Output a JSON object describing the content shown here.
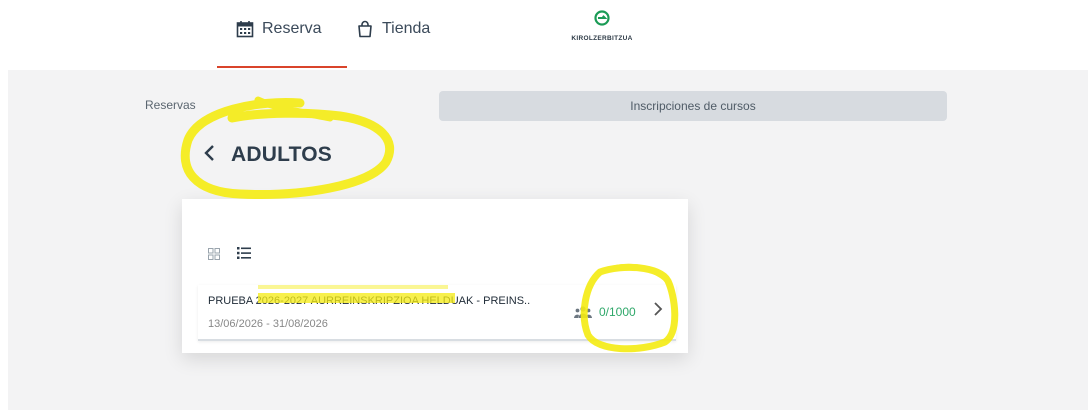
{
  "nav": {
    "reserva_label": "Reserva",
    "tienda_label": "Tienda",
    "logo_text": "KIROLZERBITZUA",
    "accent": "#d9442b",
    "logo_color": "#1a9b55"
  },
  "breadcrumb": {
    "label": "Reservas"
  },
  "tab": {
    "label": "Inscripciones de cursos"
  },
  "page": {
    "title": "ADULTOS",
    "back_icon": "chevron-left-icon"
  },
  "views": {
    "grid_icon": "grid-view-icon",
    "list_icon": "list-view-icon"
  },
  "course": {
    "name": "PRUEBA 2026-2027 AURREINSKRIPZIOA HELDUAK - PREINS..",
    "dates": "13/06/2026 - 31/08/2026",
    "count": "0/1000",
    "count_color": "#2fa86a"
  },
  "annotation_color": "#f5ec12"
}
